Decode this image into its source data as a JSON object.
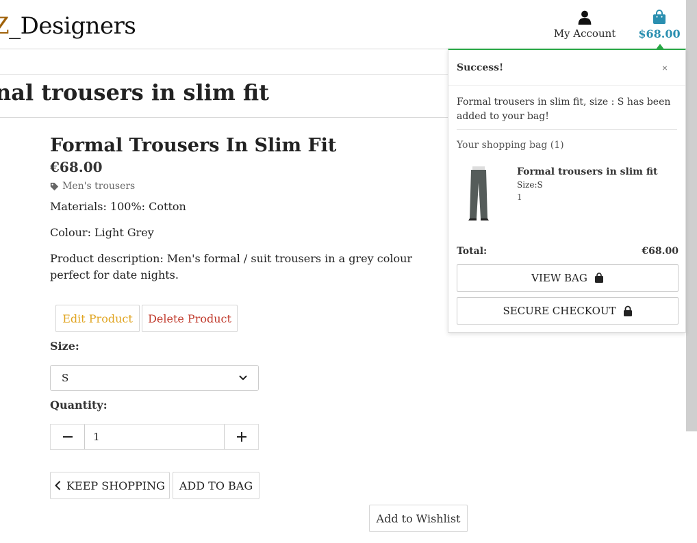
{
  "header": {
    "brand_prefix": "Z",
    "brand_name": "_Designers",
    "account_label": "My Account",
    "bag_total": "$68.00",
    "accent_color": "#2a8fb0"
  },
  "page": {
    "heading": "nal trousers in slim fit"
  },
  "product": {
    "title": "Formal Trousers In Slim Fit",
    "price": "€68.00",
    "category": "Men's trousers",
    "materials": "Materials: 100%: Cotton",
    "colour": "Colour: Light Grey",
    "description": "Product description: Men's formal / suit trousers in a grey colour perfect for date nights.",
    "edit_label": "Edit Product",
    "delete_label": "Delete Product",
    "size_label": "Size:",
    "size_value": "S",
    "quantity_label": "Quantity:",
    "quantity_value": "1",
    "keep_shopping_label": "KEEP SHOPPING",
    "add_to_bag_label": "ADD TO BAG",
    "wishlist_label": "Add to Wishlist"
  },
  "toast": {
    "title": "Success!",
    "close": "×",
    "message": "Formal trousers in slim fit, size : S has been added to your bag!",
    "bag_label": "Your shopping bag (1)",
    "item": {
      "name": "Formal trousers in slim fit",
      "size": "Size:S",
      "qty": "1"
    },
    "total_label": "Total:",
    "total_value": "€68.00",
    "view_bag_label": "VIEW BAG",
    "checkout_label": "SECURE CHECKOUT",
    "success_color": "#28a745"
  },
  "icons": {
    "account": "user-icon",
    "bag": "shopping-bag-icon",
    "tag": "tag-icon",
    "lock": "lock-icon",
    "chevron_left": "chevron-left-icon",
    "chevron_down": "chevron-down-icon",
    "minus": "minus-icon",
    "plus": "plus-icon"
  }
}
